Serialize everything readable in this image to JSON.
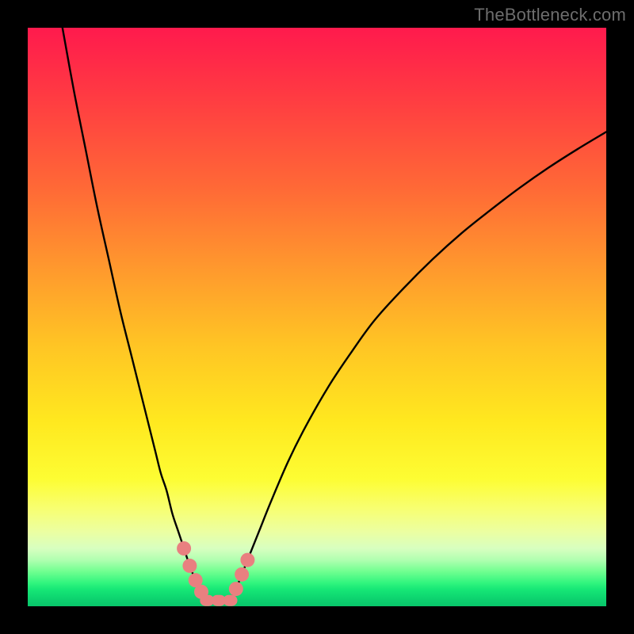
{
  "watermark": "TheBottleneck.com",
  "colors": {
    "page_bg": "#000000",
    "gradient_top": "#ff1a4d",
    "gradient_bottom": "#08c66a",
    "curve_stroke": "#000000",
    "point_fill": "#e98080"
  },
  "chart_data": {
    "type": "line",
    "title": "",
    "xlabel": "",
    "ylabel": "",
    "xlim": [
      0,
      100
    ],
    "ylim": [
      0,
      100
    ],
    "grid": false,
    "legend": "none",
    "curves": [
      {
        "name": "left_curve",
        "x": [
          6,
          8,
          10,
          12,
          14,
          16,
          18,
          20,
          22,
          23,
          24,
          25,
          26,
          27,
          28,
          29,
          30,
          31
        ],
        "y": [
          100,
          89,
          79,
          69,
          60,
          51,
          43,
          35,
          27,
          23,
          20,
          16,
          13,
          10,
          7,
          4.5,
          2.5,
          1
        ]
      },
      {
        "name": "right_curve",
        "x": [
          35,
          36,
          37,
          38,
          40,
          42,
          45,
          48,
          52,
          56,
          60,
          65,
          70,
          75,
          80,
          85,
          90,
          95,
          100
        ],
        "y": [
          1,
          3,
          5.5,
          8,
          13,
          18,
          25,
          31,
          38,
          44,
          49.5,
          55,
          60,
          64.5,
          68.5,
          72.3,
          75.8,
          79,
          82
        ]
      }
    ],
    "flat_segment": {
      "x": [
        31,
        35
      ],
      "y": [
        1,
        1
      ]
    },
    "points_highlight": [
      {
        "x": 27.0,
        "y": 10.0
      },
      {
        "x": 28.0,
        "y": 7.0
      },
      {
        "x": 29.0,
        "y": 4.5
      },
      {
        "x": 30.0,
        "y": 2.5
      },
      {
        "x": 31.0,
        "y": 1.0
      },
      {
        "x": 33.0,
        "y": 1.0
      },
      {
        "x": 35.0,
        "y": 1.0
      },
      {
        "x": 36.0,
        "y": 3.0
      },
      {
        "x": 37.0,
        "y": 5.5
      },
      {
        "x": 38.0,
        "y": 8.0
      }
    ]
  }
}
